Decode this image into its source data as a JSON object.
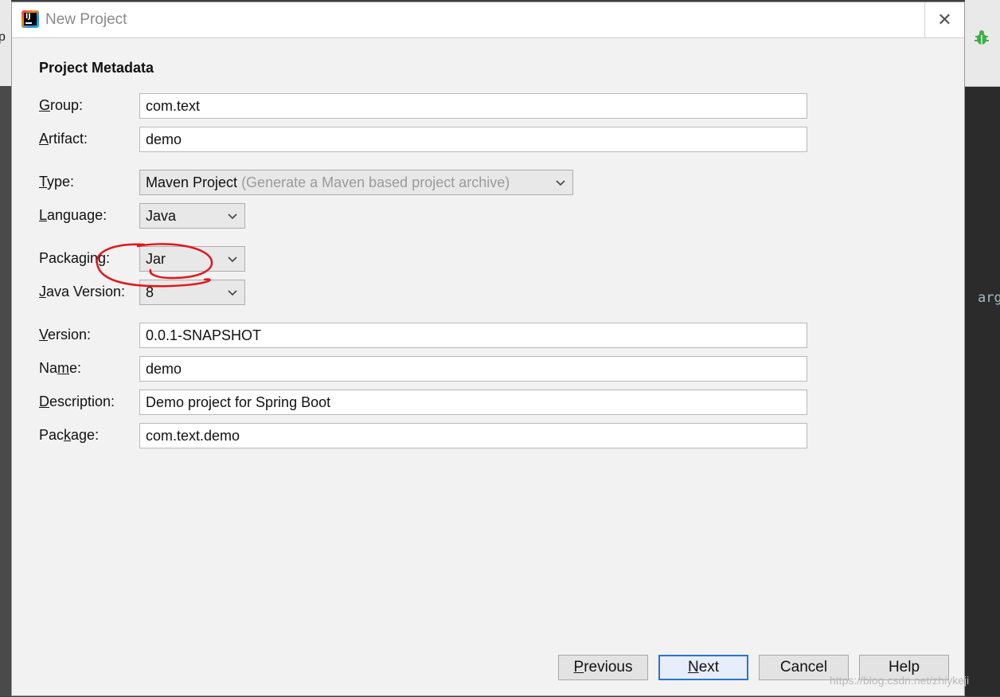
{
  "window": {
    "title": "New Project"
  },
  "section": {
    "title": "Project Metadata"
  },
  "fields": {
    "group": {
      "label_mn": "G",
      "label_rest": "roup:",
      "value": "com.text"
    },
    "artifact": {
      "label_mn": "A",
      "label_rest": "rtifact:",
      "value": "demo"
    },
    "version": {
      "label_mn": "V",
      "label_rest": "ersion:",
      "value": "0.0.1-SNAPSHOT"
    },
    "name": {
      "label_pre": "Na",
      "label_mn": "m",
      "label_rest": "e:",
      "value": "demo"
    },
    "description": {
      "label_mn": "D",
      "label_rest": "escription:",
      "value": "Demo project for Spring Boot"
    },
    "package": {
      "label_pre": "Pac",
      "label_mn": "k",
      "label_rest": "age:",
      "value": "com.text.demo"
    }
  },
  "combos": {
    "type": {
      "label_mn": "T",
      "label_rest": "ype:",
      "value": "Maven Project",
      "hint": " (Generate a Maven based project archive)"
    },
    "language": {
      "label_mn": "L",
      "label_rest": "anguage:",
      "value": "Java"
    },
    "packaging": {
      "label": "Packaging:",
      "value": "Jar"
    },
    "java_version": {
      "label_mn": "J",
      "label_rest": "ava Version:",
      "value": "8"
    }
  },
  "buttons": {
    "previous": {
      "mn": "P",
      "rest": "revious"
    },
    "next": {
      "mn": "N",
      "rest": "ext"
    },
    "cancel": {
      "label": "Cancel"
    },
    "help": {
      "label": "Help"
    }
  },
  "background": {
    "left_char": "p",
    "code_snippet": "arg",
    "watermark": "https://blog.csdn.net/zhiykeji"
  },
  "colors": {
    "annotation": "#e0161b",
    "primary_border": "#2a73d4",
    "bug_green": "#3fae49"
  },
  "icons": {
    "app": "intellij-idea-icon",
    "close": "close-icon",
    "dropdown": "chevron-down-icon",
    "bug": "debug-bug-icon"
  }
}
